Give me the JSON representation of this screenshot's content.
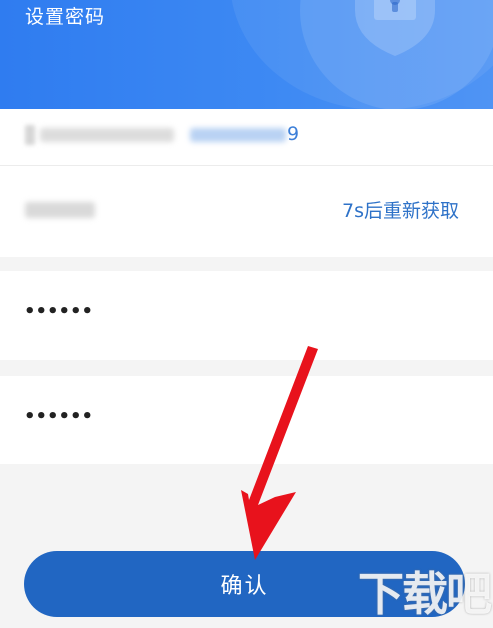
{
  "header": {
    "title": "设置密码",
    "bg_color": "#2f7cf0"
  },
  "form": {
    "phone_visible_tail": "9",
    "resend_label": "7s后重新获取",
    "password": "••••••",
    "confirm_password": "••••••"
  },
  "confirm_button": {
    "label": "确认",
    "color": "#2166c2"
  },
  "annotation": {
    "arrow_color": "#e8121c"
  },
  "watermark": {
    "text": "下载吧",
    "icon": "download-site-watermark"
  }
}
